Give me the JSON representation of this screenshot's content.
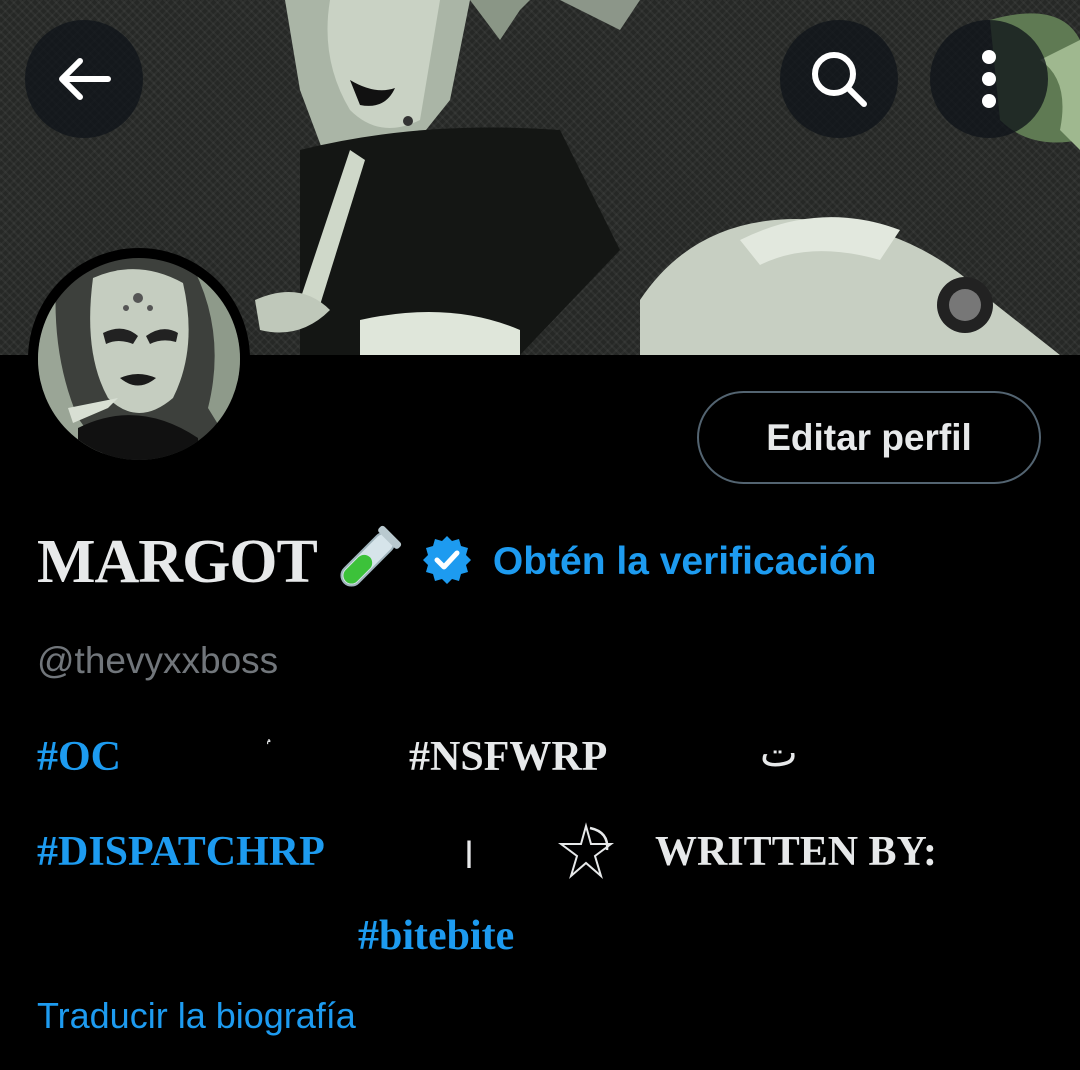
{
  "header": {
    "back_icon": "arrow-left-icon",
    "search_icon": "search-icon",
    "more_icon": "more-vertical-icon"
  },
  "profile": {
    "display_name": "MARGOT",
    "name_emoji": "test-tube-icon",
    "verified_badge": "verified-badge-icon",
    "verify_link": "Obtén la verificación",
    "handle": "@thevyxxboss",
    "edit_button": "Editar perfil"
  },
  "bio": {
    "tag_oc": "#OC",
    "glyph_nun": "ۢ",
    "tag_nsfwrp": "#NSFWRP",
    "glyph_teh": "ت",
    "tag_dispatchrp": "#DISPATCHRP",
    "glyph_alef": "ا",
    "written_by": "WRITTEN BY:",
    "tag_bitebite": "#bitebite"
  },
  "translate_link": "Traducir la biografía",
  "colors": {
    "accent": "#1d9bf0",
    "background": "#000000",
    "text": "#e7e9ea",
    "muted": "#71767b",
    "border": "#536471"
  }
}
